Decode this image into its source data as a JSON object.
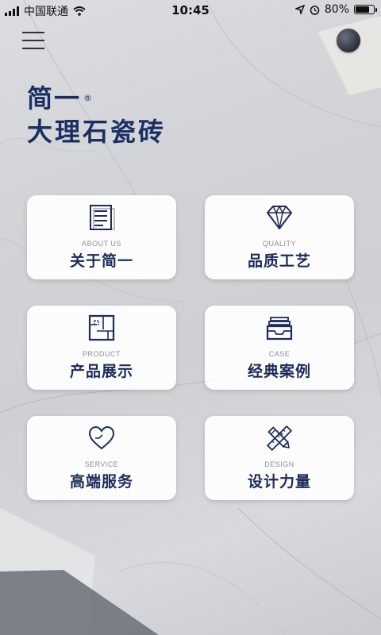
{
  "status_bar": {
    "carrier": "中国联通",
    "time": "10:45",
    "battery_percent": "80%",
    "battery_level": 0.8
  },
  "brand": {
    "name": "简一",
    "registered": "®",
    "subtitle": "大理石瓷砖"
  },
  "cards": [
    {
      "en": "ABOUT US",
      "zh": "关于简一",
      "icon": "document-icon"
    },
    {
      "en": "QUALITY",
      "zh": "品质工艺",
      "icon": "diamond-icon"
    },
    {
      "en": "PRODUCT",
      "zh": "产品展示",
      "icon": "floorplan-icon"
    },
    {
      "en": "CASE",
      "zh": "经典案例",
      "icon": "tray-icon"
    },
    {
      "en": "SERVICE",
      "zh": "高端服务",
      "icon": "heart-icon"
    },
    {
      "en": "DESIGN",
      "zh": "设计力量",
      "icon": "pencil-ruler-icon"
    }
  ],
  "colors": {
    "brand": "#1b2f63",
    "icon": "#1c2b5a"
  }
}
